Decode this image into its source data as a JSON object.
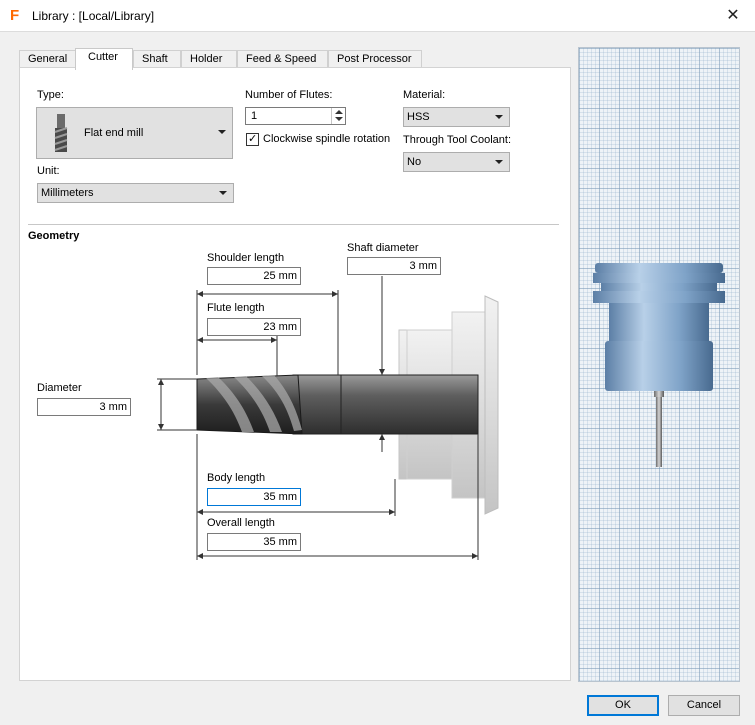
{
  "window": {
    "title": "Library :  [Local/Library]",
    "app_icon": "autodesk-f-icon",
    "close_icon": "close-icon"
  },
  "tabs": [
    {
      "label": "General"
    },
    {
      "label": "Cutter"
    },
    {
      "label": "Shaft"
    },
    {
      "label": "Holder"
    },
    {
      "label": "Feed & Speed"
    },
    {
      "label": "Post Processor"
    }
  ],
  "active_tab": "Cutter",
  "cutter": {
    "type_label": "Type:",
    "type_value": "Flat end mill",
    "unit_label": "Unit:",
    "unit_value": "Millimeters",
    "flutes_label": "Number of Flutes:",
    "flutes_value": "1",
    "clockwise_label": "Clockwise spindle rotation",
    "clockwise_checked": true,
    "material_label": "Material:",
    "material_value": "HSS",
    "coolant_label": "Through Tool Coolant:",
    "coolant_value": "No"
  },
  "geometry": {
    "title": "Geometry",
    "shoulder_length": {
      "label": "Shoulder length",
      "value": "25 mm"
    },
    "shaft_diameter": {
      "label": "Shaft diameter",
      "value": "3 mm"
    },
    "flute_length": {
      "label": "Flute length",
      "value": "23 mm"
    },
    "diameter": {
      "label": "Diameter",
      "value": "3 mm"
    },
    "body_length": {
      "label": "Body length",
      "value": "35 mm"
    },
    "overall_length": {
      "label": "Overall length",
      "value": "35 mm"
    }
  },
  "buttons": {
    "ok": "OK",
    "cancel": "Cancel"
  },
  "colors": {
    "accent": "#0078d7",
    "holder_blue": "#7fa3c8",
    "logo_orange": "#ff6a00"
  }
}
